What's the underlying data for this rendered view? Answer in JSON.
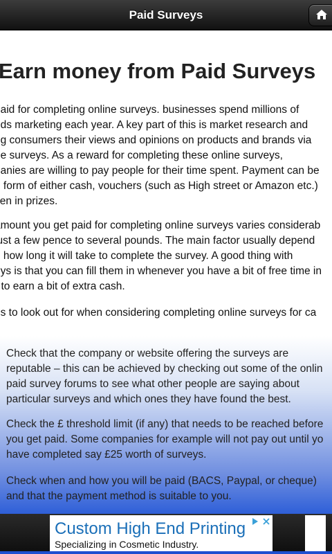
{
  "header": {
    "title": "Paid Surveys",
    "home_icon": "home-icon"
  },
  "main": {
    "heading": "Earn money from Paid Surveys",
    "para1": [
      "paid for completing online surveys. businesses spend millions of",
      "nds marketing each year.  A key part of this is market research and",
      "ng consumers their views and opinions on products and brands via",
      "ne surveys.  As a reward for completing these online surveys,",
      "panies are willing to pay people for their time spent.  Payment can be",
      "e form of either cash, vouchers (such as High street or Amazon etc.)",
      "ven in prizes."
    ],
    "para2": [
      "amount you get paid for completing online surveys varies considerab",
      " just a few pence to several pounds.  The main factor usually depend",
      "n how long it will take to complete the survey.  A good thing with",
      "eys is that you can fill them in whenever you have a bit of free time in",
      "r to earn a bit of extra cash."
    ],
    "para3": [
      "gs to look out for when considering completing online surveys for ca"
    ],
    "list": [
      [
        "Check that the company or website offering the surveys are",
        "reputable – this can be achieved by checking out some of the onlin",
        "paid survey forums to see what other people are saying about",
        "particular surveys and which ones they have found the best."
      ],
      [
        "Check the £ threshold limit (if any) that needs to be reached before",
        "you get paid.  Some companies for example will not pay out until yo",
        "have completed say £25 worth of surveys."
      ],
      [
        "Check when and how you will be paid (BACS, Paypal, or cheque)",
        "and that the payment method is suitable to you."
      ]
    ]
  },
  "ad": {
    "title": "Custom High End Printing",
    "subtitle": "Specializing in Cosmetic Industry.",
    "choice_icon": "ad-choices-icon",
    "close_icon": "close-icon"
  },
  "colors": {
    "topbar": "#1e1e1e",
    "ad_title": "#1a6fb8",
    "bottom_strip": "#1e4fd0"
  }
}
